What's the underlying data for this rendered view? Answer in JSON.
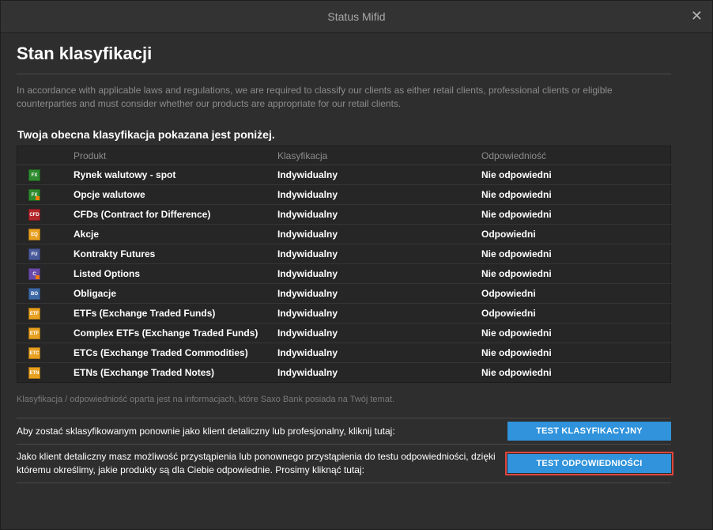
{
  "window": {
    "title": "Status Mifid",
    "close_glyph": "✕"
  },
  "header": {
    "title": "Stan klasyfikacji",
    "intro": "In accordance with applicable laws and regulations, we are required to classify our clients as either retail clients, professional clients or eligible counterparties and must consider whether our products are appropriate for our retail clients."
  },
  "classification": {
    "subtitle": "Twoja obecna klasyfikacja pokazana jest poniżej.",
    "columns": [
      "Produkt",
      "Klasyfikacja",
      "Odpowiedniość"
    ],
    "rows": [
      {
        "icon": "fx-icon",
        "badge": "FX",
        "color": "#2e8b2e",
        "quarter": false,
        "product": "Rynek walutowy - spot",
        "classification": "Indywidualny",
        "suitability": "Nie odpowiedni"
      },
      {
        "icon": "fx-options-icon",
        "badge": "FX",
        "color": "#2e8b2e",
        "quarter": true,
        "product": "Opcje walutowe",
        "classification": "Indywidualny",
        "suitability": "Nie odpowiedni"
      },
      {
        "icon": "cfd-icon",
        "badge": "CFD",
        "color": "#b3262b",
        "quarter": false,
        "product": "CFDs (Contract for Difference)",
        "classification": "Indywidualny",
        "suitability": "Nie odpowiedni"
      },
      {
        "icon": "eq-icon",
        "badge": "EQ",
        "color": "#e8a020",
        "quarter": false,
        "product": "Akcje",
        "classification": "Indywidualny",
        "suitability": "Odpowiedni"
      },
      {
        "icon": "fu-icon",
        "badge": "FU",
        "color": "#4a5a9a",
        "quarter": false,
        "product": "Kontrakty Futures",
        "classification": "Indywidualny",
        "suitability": "Nie odpowiedni"
      },
      {
        "icon": "listed-options-icon",
        "badge": "C",
        "color": "#6a4aa8",
        "quarter": true,
        "product": "Listed Options",
        "classification": "Indywidualny",
        "suitability": "Nie odpowiedni"
      },
      {
        "icon": "bo-icon",
        "badge": "BO",
        "color": "#3e6aa8",
        "quarter": false,
        "product": "Obligacje",
        "classification": "Indywidualny",
        "suitability": "Odpowiedni"
      },
      {
        "icon": "etf-icon",
        "badge": "ETF",
        "color": "#e8a020",
        "quarter": false,
        "product": "ETFs (Exchange Traded Funds)",
        "classification": "Indywidualny",
        "suitability": "Odpowiedni"
      },
      {
        "icon": "complex-etf-icon",
        "badge": "ETF",
        "color": "#e8a020",
        "quarter": false,
        "product": "Complex ETFs (Exchange Traded Funds)",
        "classification": "Indywidualny",
        "suitability": "Nie odpowiedni"
      },
      {
        "icon": "etc-icon",
        "badge": "ETC",
        "color": "#e8a020",
        "quarter": false,
        "product": "ETCs (Exchange Traded Commodities)",
        "classification": "Indywidualny",
        "suitability": "Nie odpowiedni"
      },
      {
        "icon": "etn-icon",
        "badge": "ETN",
        "color": "#e8a020",
        "quarter": false,
        "product": "ETNs (Exchange Traded Notes)",
        "classification": "Indywidualny",
        "suitability": "Nie odpowiedni"
      }
    ],
    "note": "Klasyfikacja / odpowiedniość oparta jest na informacjach, które Saxo Bank posiada na Twój temat."
  },
  "actions": {
    "classification_text": "Aby zostać sklasyfikowanym ponownie jako klient detaliczny lub profesjonalny, kliknij tutaj:",
    "classification_button": "TEST KLASYFIKACYJNY",
    "suitability_text": "Jako klient detaliczny masz możliwość przystąpienia lub ponownego przystąpienia do testu odpowiedniości, dzięki któremu określimy, jakie produkty są dla Ciebie odpowiednie. Prosimy kliknąć tutaj:",
    "suitability_button": "TEST ODPOWIEDNIOŚCI"
  }
}
